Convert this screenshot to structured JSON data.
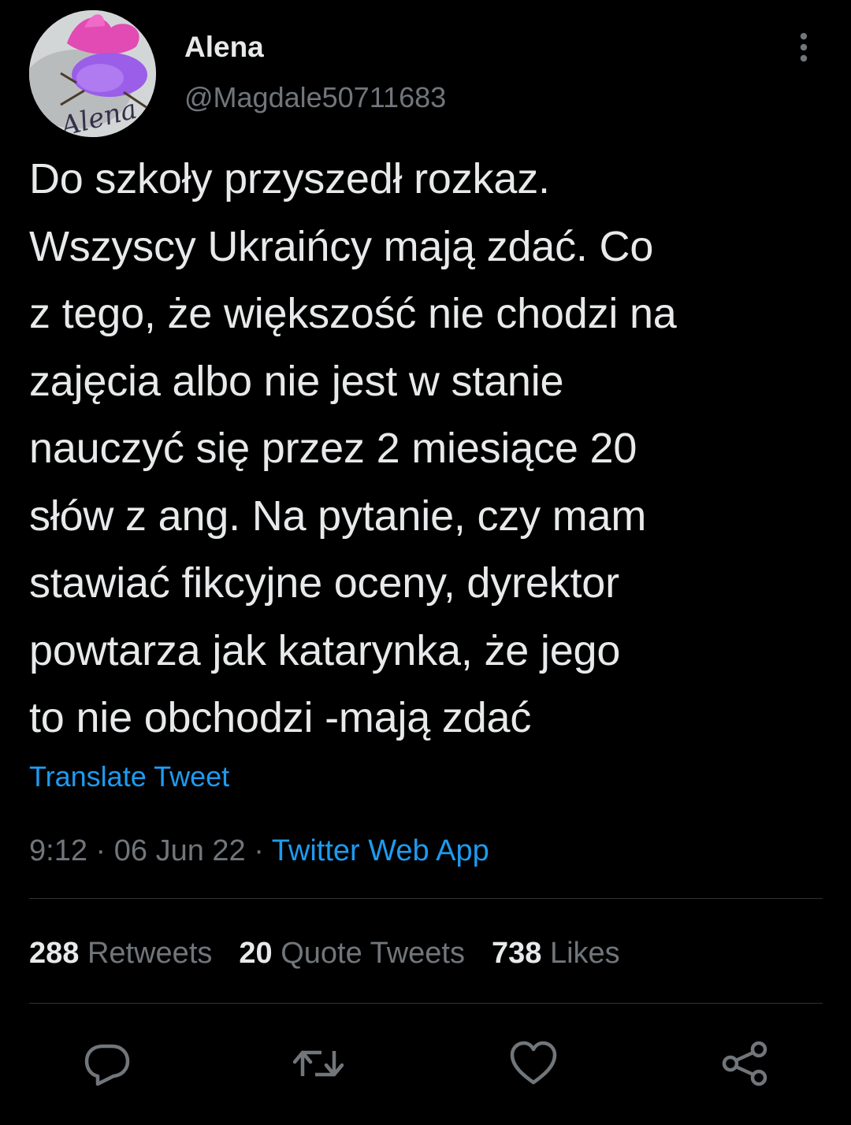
{
  "author": {
    "display_name": "Alena",
    "handle": "@Magdale50711683",
    "avatar_text": "Alena"
  },
  "tweet": {
    "text": "Do szkoły przyszedł rozkaz.\nWszyscy Ukraińcy mają zdać. Co\nz tego, że większość nie chodzi na\nzajęcia albo nie jest w stanie\nnauczyć się przez 2 miesiące 20\nsłów z ang. Na pytanie, czy mam\nstawiać fikcyjne oceny, dyrektor\npowtarza jak katarynka, że jego\nto nie obchodzi -mają zdać",
    "translate_label": "Translate Tweet"
  },
  "meta": {
    "time": "9:12",
    "separator": " · ",
    "date": "06 Jun 22",
    "source": "Twitter Web App"
  },
  "stats": {
    "retweets_count": "288",
    "retweets_label": "Retweets",
    "quotes_count": "20",
    "quotes_label": "Quote Tweets",
    "likes_count": "738",
    "likes_label": "Likes"
  },
  "actions": {
    "reply": "reply-icon",
    "retweet": "retweet-icon",
    "like": "heart-icon",
    "share": "share-icon"
  },
  "colors": {
    "background": "#000000",
    "text_primary": "#e7e9ea",
    "text_secondary": "#71767b",
    "accent": "#1d9bf0",
    "divider": "#2f3336"
  }
}
